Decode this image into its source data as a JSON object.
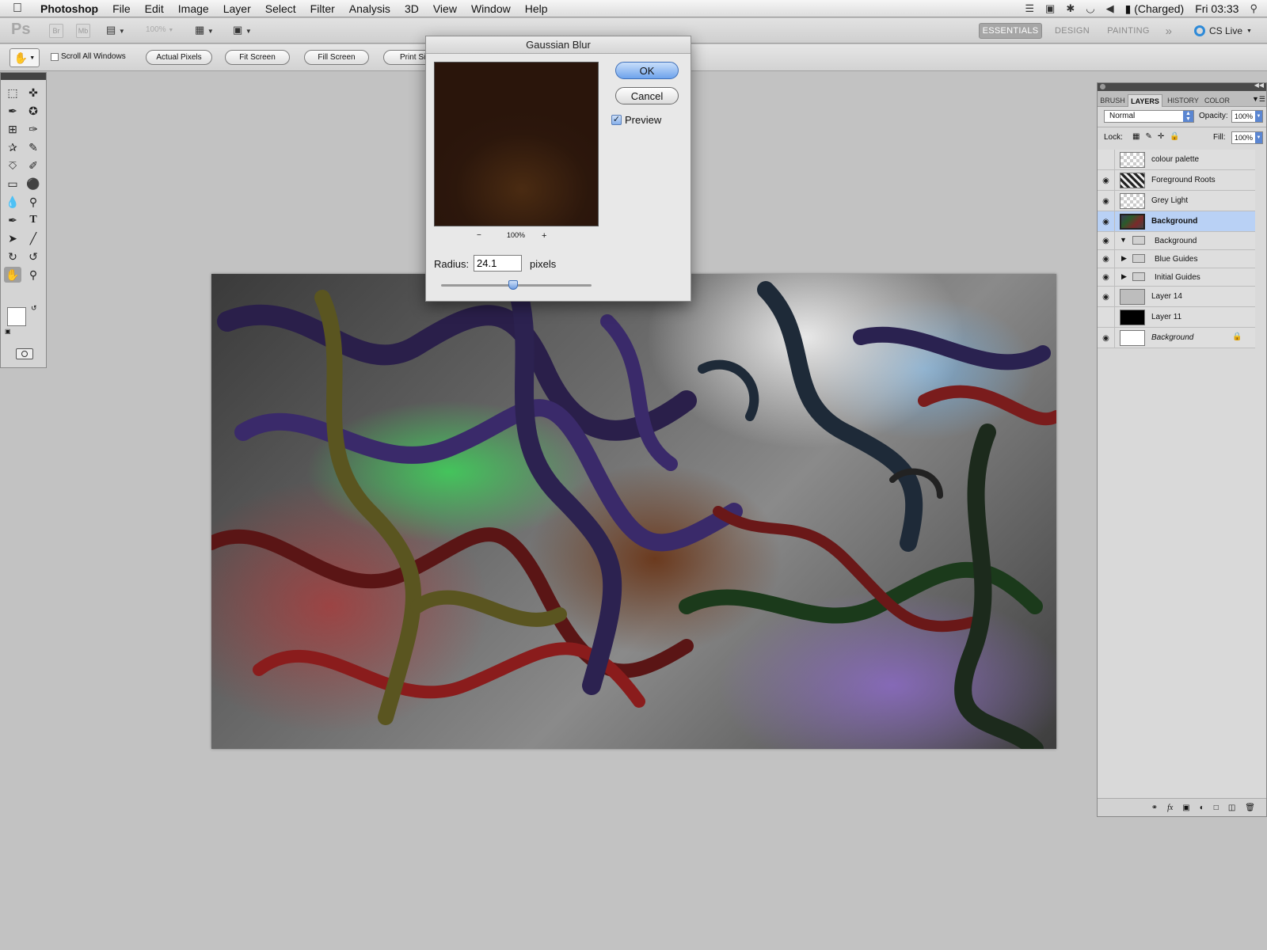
{
  "menubar": {
    "app": "Photoshop",
    "items": [
      "File",
      "Edit",
      "Image",
      "Layer",
      "Select",
      "Filter",
      "Analysis",
      "3D",
      "View",
      "Window",
      "Help"
    ],
    "battery": "(Charged)",
    "clock": "Fri 03:33"
  },
  "appbar": {
    "logo": "Ps",
    "br": "Br",
    "mb": "Mb",
    "zoom": "100%",
    "workspaces": [
      "ESSENTIALS",
      "DESIGN",
      "PAINTING"
    ],
    "more": "»",
    "cs_live": "CS Live"
  },
  "options": {
    "scroll_all": "Scroll All Windows",
    "buttons": [
      "Actual Pixels",
      "Fit Screen",
      "Fill Screen",
      "Print Si"
    ]
  },
  "dialog": {
    "title": "Gaussian Blur",
    "ok": "OK",
    "cancel": "Cancel",
    "preview_label": "Preview",
    "preview_checked": true,
    "zoom_minus": "−",
    "zoom_level": "100%",
    "zoom_plus": "+",
    "radius_label": "Radius:",
    "radius_value": "24.1",
    "radius_unit": "pixels",
    "slider_fraction": 0.48
  },
  "layers_panel": {
    "tabs": [
      "BRUSH",
      "LAYERS",
      "HISTORY",
      "COLOR"
    ],
    "blend_mode": "Normal",
    "opacity_label": "Opacity:",
    "opacity": "100%",
    "lock_label": "Lock:",
    "fill_label": "Fill:",
    "fill": "100%",
    "layers": [
      {
        "name": "colour palette",
        "visible": false,
        "thumb": "checker"
      },
      {
        "name": "Foreground Roots",
        "visible": true,
        "thumb": "roots"
      },
      {
        "name": "Grey Light",
        "visible": true,
        "thumb": "checker"
      },
      {
        "name": "Background",
        "visible": true,
        "thumb": "image",
        "selected": true
      },
      {
        "name": "Background",
        "visible": true,
        "thumb": "folder",
        "group": true,
        "expanded": true
      },
      {
        "name": "Blue Guides",
        "visible": true,
        "thumb": "folder",
        "group": true
      },
      {
        "name": "Initial Guides",
        "visible": true,
        "thumb": "folder",
        "group": true
      },
      {
        "name": "Layer 14",
        "visible": true,
        "thumb": "grey"
      },
      {
        "name": "Layer 11",
        "visible": false,
        "thumb": "black"
      },
      {
        "name": "Background",
        "visible": true,
        "thumb": "white",
        "locked": true
      }
    ]
  },
  "colors": {
    "selection": "#b9d1f5",
    "default_button": "#6ea3ec"
  }
}
